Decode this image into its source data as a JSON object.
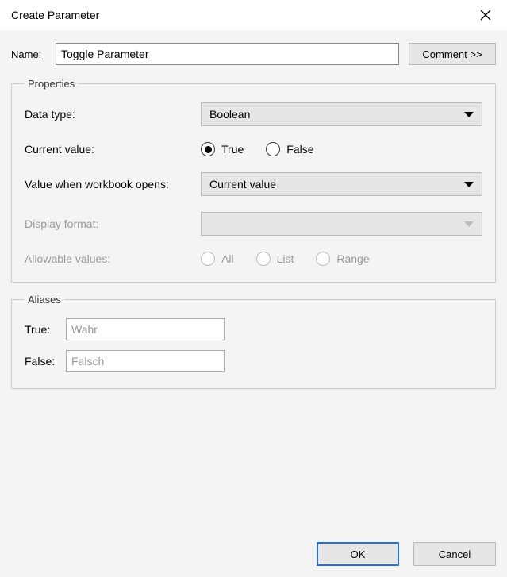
{
  "dialog": {
    "title": "Create Parameter"
  },
  "name": {
    "label": "Name:",
    "value": "Toggle Parameter"
  },
  "comment_button": "Comment >>",
  "properties": {
    "legend": "Properties",
    "data_type": {
      "label": "Data type:",
      "value": "Boolean"
    },
    "current_value": {
      "label": "Current value:",
      "options": {
        "true": "True",
        "false": "False"
      },
      "selected": "true"
    },
    "workbook_open": {
      "label": "Value when workbook opens:",
      "value": "Current value"
    },
    "display_format": {
      "label": "Display format:",
      "value": ""
    },
    "allowable_values": {
      "label": "Allowable values:",
      "options": {
        "all": "All",
        "list": "List",
        "range": "Range"
      }
    }
  },
  "aliases": {
    "legend": "Aliases",
    "true": {
      "label": "True:",
      "value": "Wahr"
    },
    "false": {
      "label": "False:",
      "value": "Falsch"
    }
  },
  "footer": {
    "ok": "OK",
    "cancel": "Cancel"
  }
}
